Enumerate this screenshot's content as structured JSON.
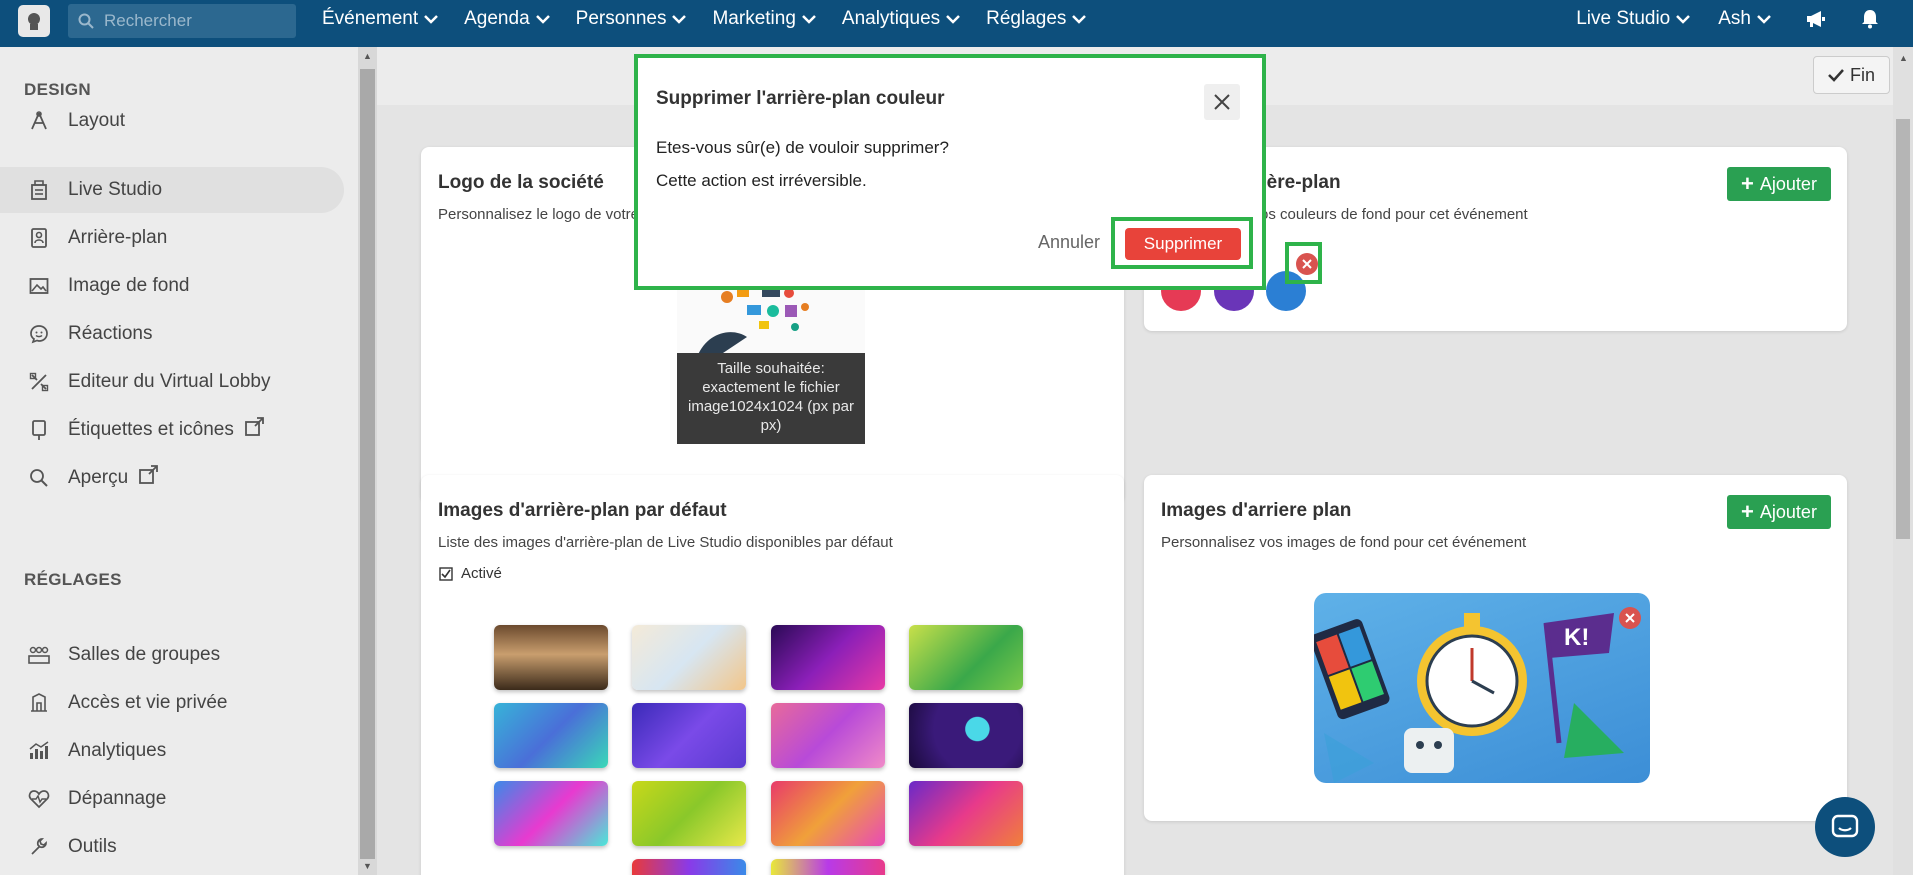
{
  "topbar": {
    "search_placeholder": "Rechercher",
    "nav": [
      "Événement",
      "Agenda",
      "Personnes",
      "Marketing",
      "Analytiques",
      "Réglages"
    ],
    "right": [
      "Live Studio",
      "Ash"
    ]
  },
  "sidebar": {
    "design_heading": "DESIGN",
    "design_items": [
      {
        "label": "Layout",
        "icon": "layout-icon"
      },
      {
        "label": "Live Studio",
        "icon": "studio-icon"
      },
      {
        "label": "Arrière-plan",
        "icon": "background-icon"
      },
      {
        "label": "Image de fond",
        "icon": "image-icon"
      },
      {
        "label": "Réactions",
        "icon": "reactions-icon"
      },
      {
        "label": "Editeur du Virtual Lobby",
        "icon": "lobby-editor-icon"
      },
      {
        "label": "Étiquettes et icônes",
        "icon": "labels-icon"
      },
      {
        "label": "Aperçu",
        "icon": "preview-icon"
      }
    ],
    "settings_heading": "RÉGLAGES",
    "settings_items": [
      {
        "label": "Salles de groupes",
        "icon": "groups-icon"
      },
      {
        "label": "Accès et vie privée",
        "icon": "privacy-icon"
      },
      {
        "label": "Analytiques",
        "icon": "analytics-icon"
      },
      {
        "label": "Dépannage",
        "icon": "troubleshoot-icon"
      },
      {
        "label": "Outils",
        "icon": "tools-icon"
      }
    ]
  },
  "toolbar": {
    "fin_label": "Fin"
  },
  "logo_card": {
    "title": "Logo de la société",
    "desc": "Personnalisez le logo de votre",
    "overlay": "Taille souhaitée: exactement le fichier image1024x1024 (px par px)"
  },
  "colors_card": {
    "title": "rière-plan",
    "desc": "os couleurs de fond pour cet événement",
    "add_label": "Ajouter",
    "swatches": [
      "#e63a55",
      "#6a35b8",
      "#2b7fd4"
    ]
  },
  "default_bg_card": {
    "title": "Images d'arrière-plan par défaut",
    "desc": "Liste des images d'arrière-plan de Live Studio disponibles par défaut",
    "checkbox_label": "Activé"
  },
  "custom_bg_card": {
    "title": "Images d'arriere plan",
    "desc": "Personnalisez vos images de fond pour cet événement",
    "add_label": "Ajouter"
  },
  "modal": {
    "title": "Supprimer l'arrière-plan couleur",
    "line1": "Etes-vous sûr(e) de vouloir supprimer?",
    "line2": "Cette action est irréversible.",
    "cancel_label": "Annuler",
    "confirm_label": "Supprimer"
  },
  "colors": {
    "navbar": "#0d4f7c",
    "add_green": "#2aa052",
    "danger": "#e8433a",
    "highlight": "#2eb34a"
  }
}
